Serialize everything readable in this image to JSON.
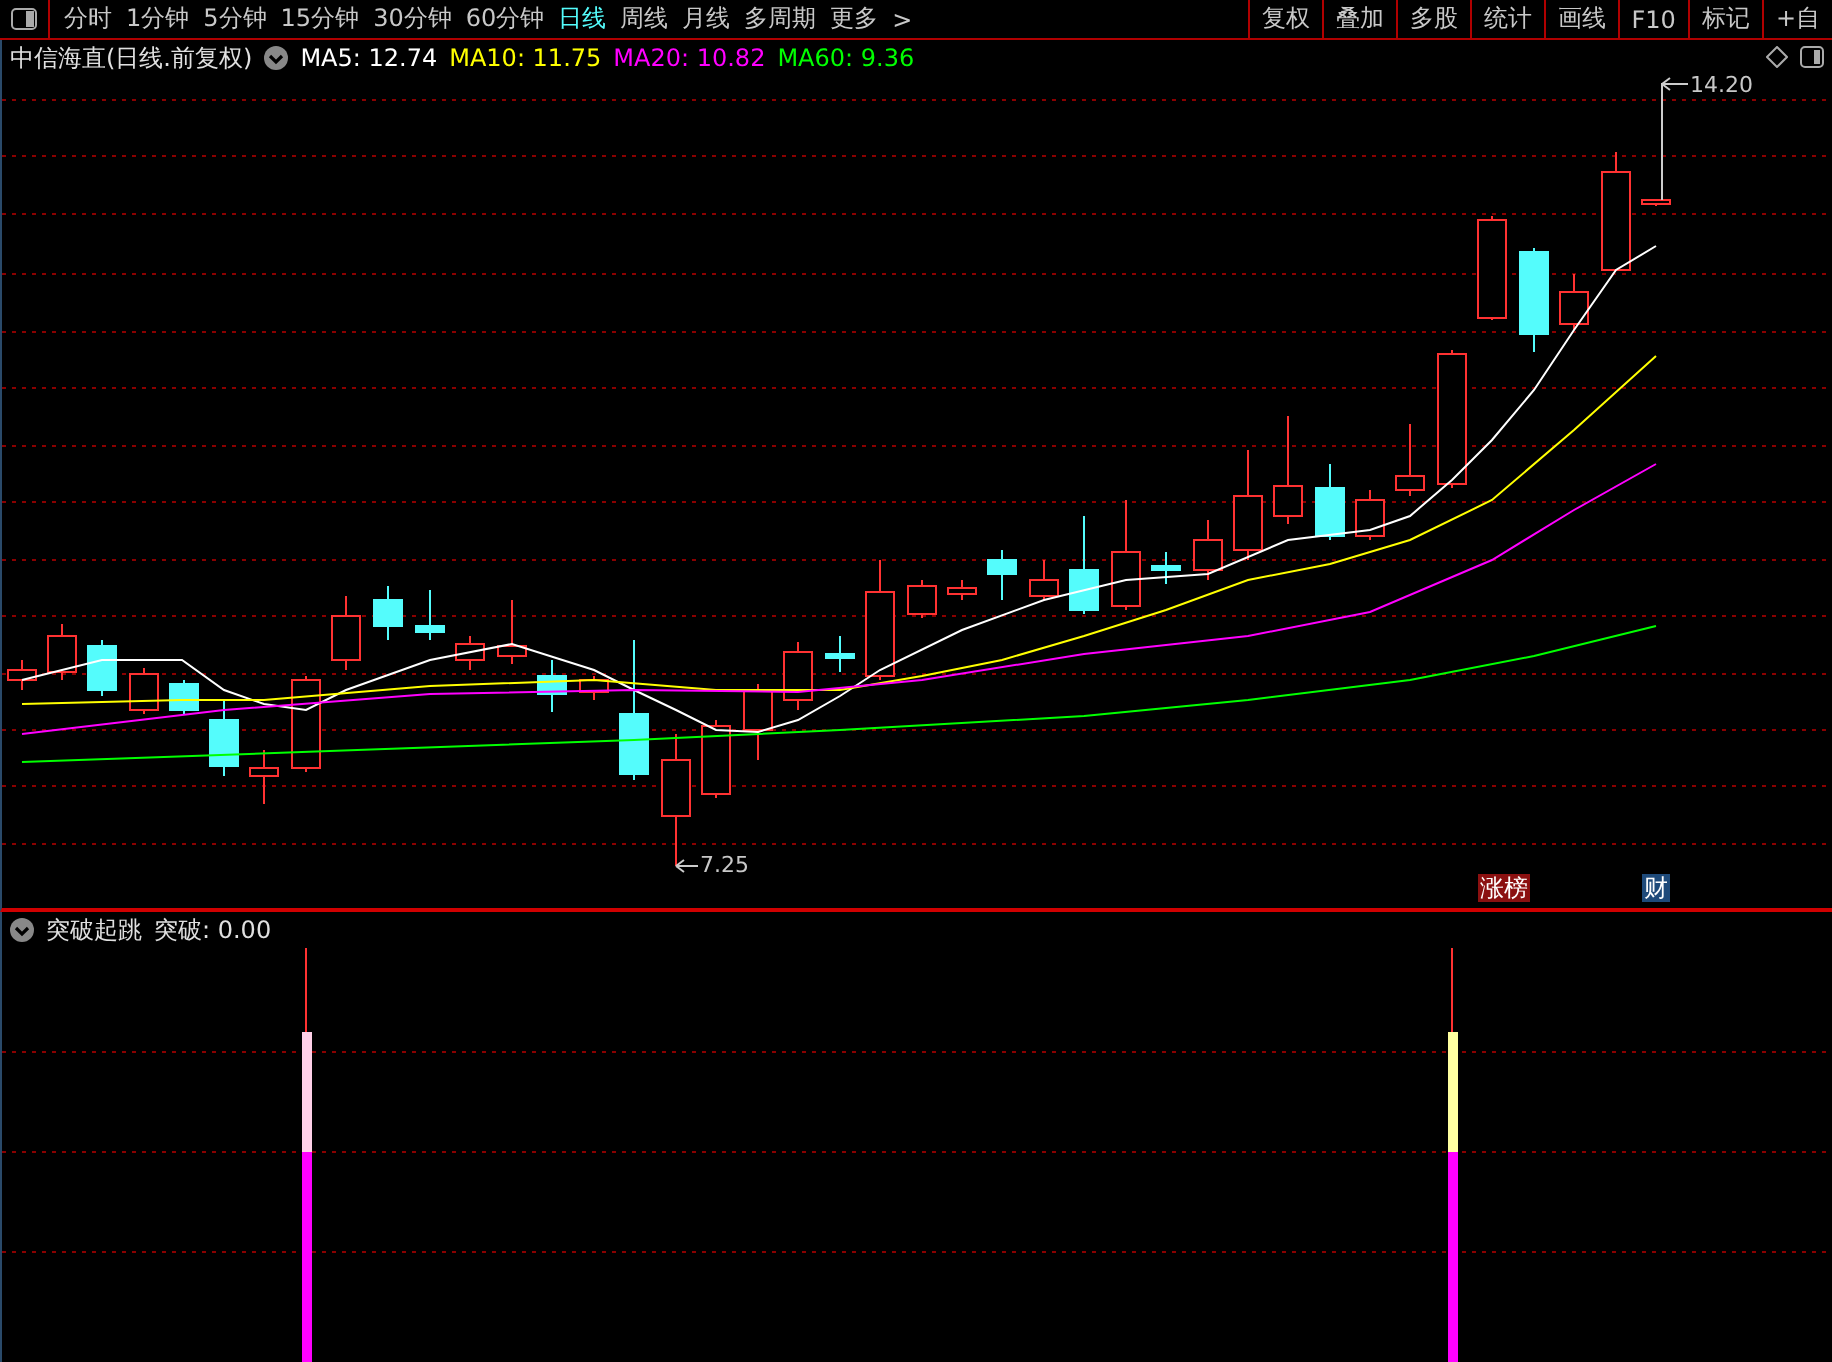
{
  "toolbar": {
    "periods": [
      {
        "label": "分时",
        "selected": false
      },
      {
        "label": "1分钟",
        "selected": false
      },
      {
        "label": "5分钟",
        "selected": false
      },
      {
        "label": "15分钟",
        "selected": false
      },
      {
        "label": "30分钟",
        "selected": false
      },
      {
        "label": "60分钟",
        "selected": false
      },
      {
        "label": "日线",
        "selected": true
      },
      {
        "label": "周线",
        "selected": false
      },
      {
        "label": "月线",
        "selected": false
      },
      {
        "label": "多周期",
        "selected": false
      },
      {
        "label": "更多",
        "selected": false
      }
    ],
    "more_arrow": ">",
    "buttons": [
      "复权",
      "叠加",
      "多股",
      "统计",
      "画线",
      "F10",
      "标记",
      "+自"
    ]
  },
  "chart": {
    "title": "中信海直(日线.前复权)",
    "moving_averages": [
      {
        "label": "MA5: 12.74",
        "color": "#ffffff"
      },
      {
        "label": "MA10: 11.75",
        "color": "#ffff00"
      },
      {
        "label": "MA20: 10.82",
        "color": "#ff00ff"
      },
      {
        "label": "MA60: 9.36",
        "color": "#00ff00"
      }
    ],
    "high_label": "14.20",
    "low_label": "7.25",
    "badges": [
      {
        "text": "涨榜",
        "color": "#8b1010"
      },
      {
        "text": "财",
        "color": "#1e4a7a"
      }
    ]
  },
  "indicator": {
    "name": "突破起跳",
    "reading": "突破: 0.00"
  }
}
